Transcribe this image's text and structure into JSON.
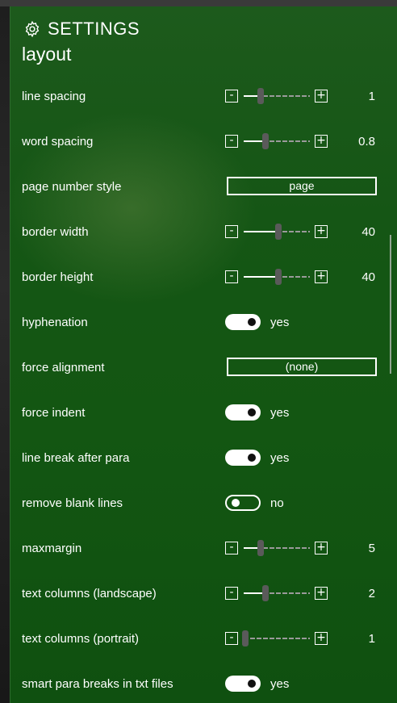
{
  "header": {
    "title": "SETTINGS",
    "icon": "gear-icon"
  },
  "section": {
    "title": "layout"
  },
  "rows": [
    {
      "label": "line spacing",
      "type": "slider",
      "value": "1",
      "level": 0.25
    },
    {
      "label": "word spacing",
      "type": "slider",
      "value": "0.8",
      "level": 0.33
    },
    {
      "label": "page number style",
      "type": "select",
      "value": "page"
    },
    {
      "label": "border width",
      "type": "slider",
      "value": "40",
      "level": 0.53
    },
    {
      "label": "border height",
      "type": "slider",
      "value": "40",
      "level": 0.53
    },
    {
      "label": "hyphenation",
      "type": "toggle",
      "on": true,
      "value": "yes"
    },
    {
      "label": "force alignment",
      "type": "select",
      "value": "(none)"
    },
    {
      "label": "force indent",
      "type": "toggle",
      "on": true,
      "value": "yes"
    },
    {
      "label": "line break after para",
      "type": "toggle",
      "on": true,
      "value": "yes"
    },
    {
      "label": "remove blank lines",
      "type": "toggle",
      "on": false,
      "value": "no"
    },
    {
      "label": "maxmargin",
      "type": "slider",
      "value": "5",
      "level": 0.25
    },
    {
      "label": "text columns (landscape)",
      "type": "slider",
      "value": "2",
      "level": 0.33
    },
    {
      "label": "text columns (portrait)",
      "type": "slider",
      "value": "1",
      "level": 0.03
    },
    {
      "label": "smart para breaks in txt files",
      "type": "toggle",
      "on": true,
      "value": "yes"
    }
  ]
}
